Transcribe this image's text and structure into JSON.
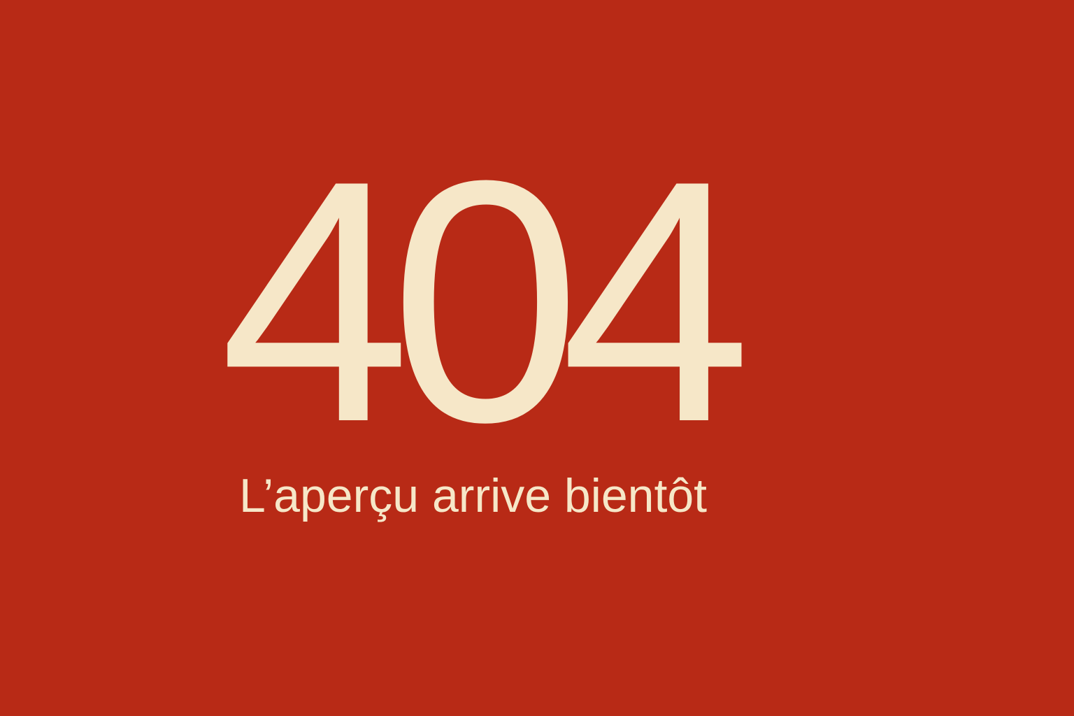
{
  "page": {
    "background_color": "#b82a16",
    "text_color": "#f6e7c8"
  },
  "error": {
    "code": "404",
    "message": "L’aperçu arrive bientôt"
  }
}
